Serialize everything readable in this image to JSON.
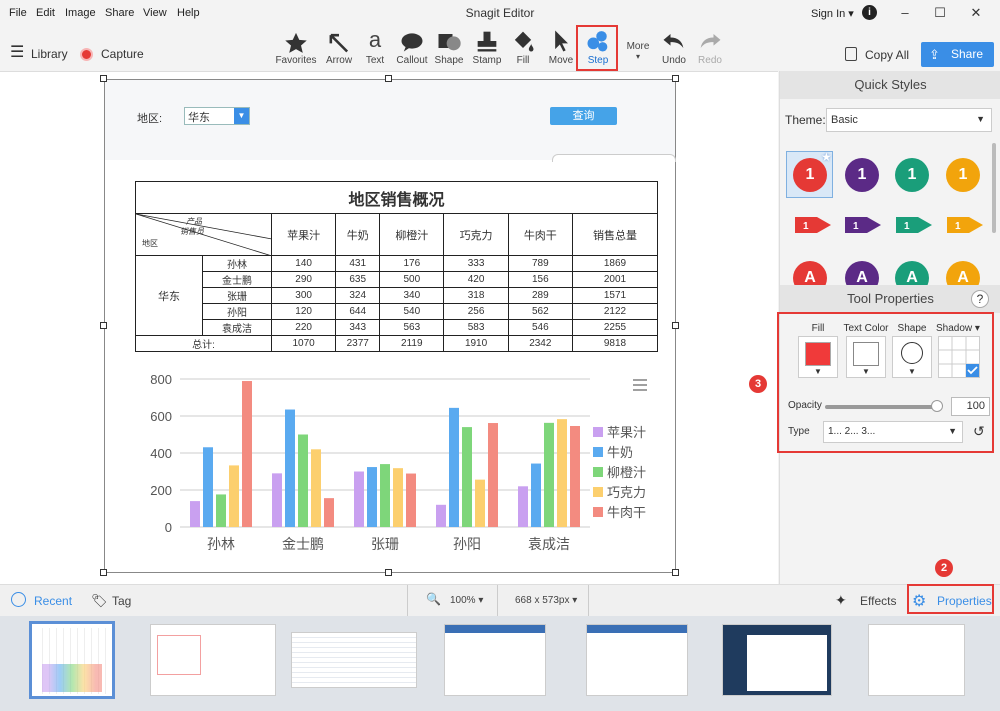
{
  "menubar": {
    "items": [
      "File",
      "Edit",
      "Image",
      "Share",
      "View",
      "Help"
    ],
    "title": "Snagit Editor",
    "signin": "Sign In"
  },
  "toolbar": {
    "library": "Library",
    "capture": "Capture",
    "tools": [
      "Favorites",
      "Arrow",
      "Text",
      "Callout",
      "Shape",
      "Stamp",
      "Fill",
      "Move",
      "Step"
    ],
    "more": "More",
    "undo": "Undo",
    "redo": "Redo",
    "copy_all": "Copy All",
    "share": "Share",
    "tool_text_glyph": "a"
  },
  "annotations": {
    "badge1": "1",
    "badge2": "2",
    "badge3": "3"
  },
  "document": {
    "region_label": "地区:",
    "region_value": "华东",
    "query_button": "查询",
    "table": {
      "title": "地区销售概况",
      "diag_top": "产品",
      "diag_mid": "销售员",
      "diag_bottom": "地区",
      "headers": [
        "苹果汁",
        "牛奶",
        "柳橙汁",
        "巧克力",
        "牛肉干",
        "销售总量"
      ],
      "region": "华东",
      "rows": [
        {
          "name": "孙林",
          "values": [
            "140",
            "431",
            "176",
            "333",
            "789",
            "1869"
          ]
        },
        {
          "name": "金士鹏",
          "values": [
            "290",
            "635",
            "500",
            "420",
            "156",
            "2001"
          ]
        },
        {
          "name": "张珊",
          "values": [
            "300",
            "324",
            "340",
            "318",
            "289",
            "1571"
          ]
        },
        {
          "name": "孙阳",
          "values": [
            "120",
            "644",
            "540",
            "256",
            "562",
            "2122"
          ]
        },
        {
          "name": "袁成洁",
          "values": [
            "220",
            "343",
            "563",
            "583",
            "546",
            "2255"
          ]
        }
      ],
      "total_label": "总计:",
      "totals": [
        "1070",
        "2377",
        "2119",
        "1910",
        "2342",
        "9818"
      ]
    }
  },
  "chart_data": {
    "type": "bar",
    "categories": [
      "孙林",
      "金士鹏",
      "张珊",
      "孙阳",
      "袁成洁"
    ],
    "series": [
      {
        "name": "苹果汁",
        "color": "#c9a0f0",
        "values": [
          140,
          290,
          300,
          120,
          220
        ]
      },
      {
        "name": "牛奶",
        "color": "#5aaaf0",
        "values": [
          431,
          635,
          324,
          644,
          343
        ]
      },
      {
        "name": "柳橙汁",
        "color": "#7ed67a",
        "values": [
          176,
          500,
          340,
          540,
          563
        ]
      },
      {
        "name": "巧克力",
        "color": "#fccf6e",
        "values": [
          333,
          420,
          318,
          256,
          583
        ]
      },
      {
        "name": "牛肉干",
        "color": "#f38b80",
        "values": [
          789,
          156,
          289,
          562,
          546
        ]
      }
    ],
    "yticks": [
      "0",
      "200",
      "400",
      "600",
      "800"
    ],
    "ylim": [
      0,
      800
    ],
    "legend_position": "right",
    "grid": true
  },
  "right_panel": {
    "quick_styles": "Quick Styles",
    "theme_label": "Theme:",
    "theme_value": "Basic",
    "style_numbers": [
      "1",
      "1",
      "1",
      "1"
    ],
    "style_letters": [
      "A",
      "A",
      "A",
      "A"
    ],
    "tool_properties": "Tool Properties",
    "help": "?",
    "fill": "Fill",
    "text_color": "Text Color",
    "shape": "Shape",
    "shadow": "Shadow",
    "opacity_label": "Opacity",
    "opacity_value": "100",
    "type_label": "Type",
    "type_value": "1... 2... 3..."
  },
  "bottombar": {
    "recent": "Recent",
    "tag": "Tag",
    "zoom": "100%",
    "size": "668 x 573px",
    "effects": "Effects",
    "properties": "Properties"
  },
  "colors": {
    "accent": "#3a8ee6",
    "annotation_red": "#e53935",
    "style_red": "#e53935",
    "style_purple": "#5b2a86",
    "style_teal": "#1a9e7a",
    "style_orange": "#f2a40c"
  }
}
